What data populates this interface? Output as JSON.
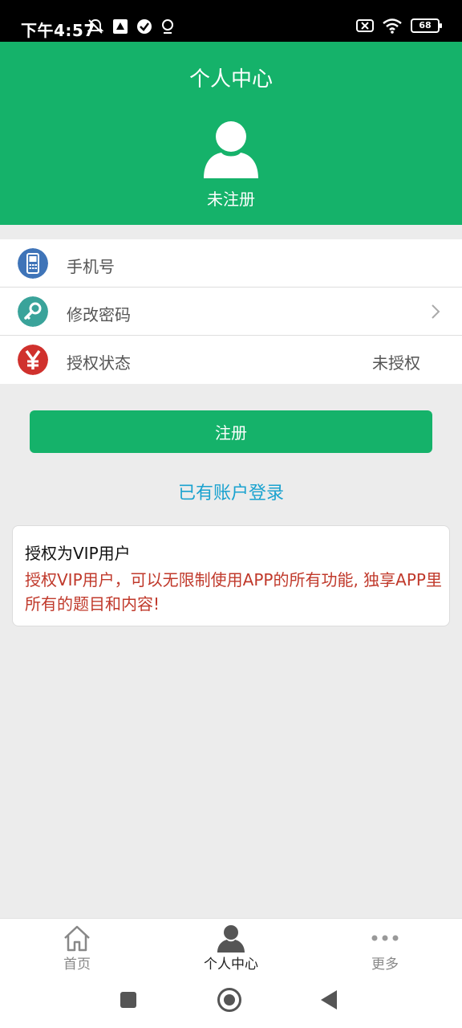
{
  "status_bar": {
    "time": "下午4:57",
    "battery": "68"
  },
  "header": {
    "title": "个人中心",
    "user_status": "未注册"
  },
  "list": [
    {
      "label": "手机号",
      "value": "",
      "icon": "phone-icon",
      "color": "#3f74b8"
    },
    {
      "label": "修改密码",
      "value": "",
      "icon": "key-icon",
      "color": "#3aa39a"
    },
    {
      "label": "授权状态",
      "value": "未授权",
      "icon": "yen-icon",
      "color": "#d0312d"
    }
  ],
  "register_button": "注册",
  "login_link": "已有账户登录",
  "vip_card": {
    "title": "授权为VIP用户",
    "description": "授权VIP用户，可以无限制使用APP的所有功能, 独享APP里所有的题目和内容!"
  },
  "bottom_nav": [
    {
      "label": "首页",
      "icon": "home-icon",
      "active": false
    },
    {
      "label": "个人中心",
      "icon": "person-icon",
      "active": true
    },
    {
      "label": "更多",
      "icon": "more-icon",
      "active": false
    }
  ],
  "colors": {
    "primary": "#15b26a",
    "link": "#1aa2cf",
    "warning_text": "#c0392b"
  }
}
